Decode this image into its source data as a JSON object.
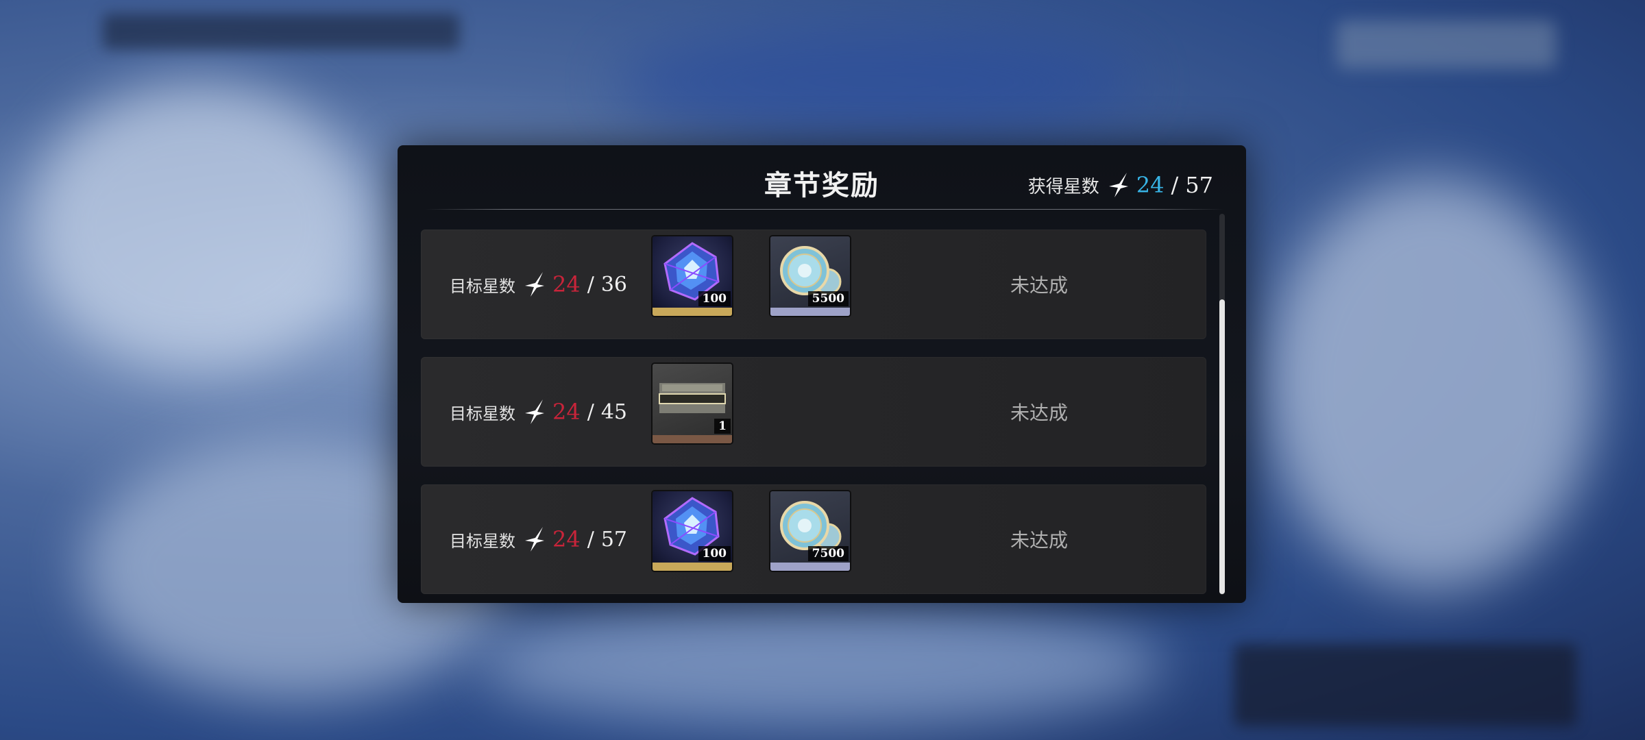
{
  "panel": {
    "title": "章节奖励",
    "earned_stars_label": "获得星数",
    "earned_current": "24",
    "earned_separator": "/",
    "earned_total": "57"
  },
  "rows": [
    {
      "target_label": "目标星数",
      "current": "24",
      "separator": "/",
      "target": "36",
      "status": "未达成",
      "rewards": [
        {
          "icon": "crystal-icon",
          "quantity": "100",
          "rarity_color": "#c8a85a"
        },
        {
          "icon": "coins-icon",
          "quantity": "5500",
          "rarity_color": "#9ea2c8"
        }
      ]
    },
    {
      "target_label": "目标星数",
      "current": "24",
      "separator": "/",
      "target": "45",
      "status": "未达成",
      "rewards": [
        {
          "icon": "nameplate-icon",
          "quantity": "1",
          "rarity_color": "#7a5845"
        }
      ]
    },
    {
      "target_label": "目标星数",
      "current": "24",
      "separator": "/",
      "target": "57",
      "status": "未达成",
      "rewards": [
        {
          "icon": "crystal-icon",
          "quantity": "100",
          "rarity_color": "#c8a85a"
        },
        {
          "icon": "coins-icon",
          "quantity": "7500",
          "rarity_color": "#9ea2c8"
        }
      ]
    }
  ],
  "colors": {
    "current_stars_header": "#38b4e6",
    "current_stars_row": "#c8243a",
    "panel_bg": "#13161d",
    "row_bg": "#262628"
  },
  "scroll": {
    "position_fraction": 0.22
  }
}
